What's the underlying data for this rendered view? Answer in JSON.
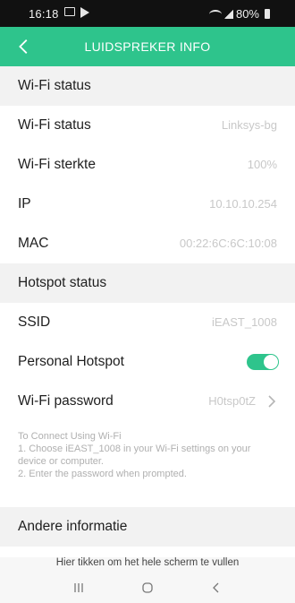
{
  "status_bar": {
    "time": "16:18",
    "battery": "80%"
  },
  "app_bar": {
    "title": "LUIDSPREKER INFO"
  },
  "sections": {
    "wifi_header": "Wi-Fi status",
    "wifi_status": {
      "label": "Wi-Fi status",
      "value": "Linksys-bg"
    },
    "wifi_strength": {
      "label": "Wi-Fi sterkte",
      "value": "100%"
    },
    "ip": {
      "label": "IP",
      "value": "10.10.10.254"
    },
    "mac": {
      "label": "MAC",
      "value": "00:22:6C:6C:10:08"
    },
    "hotspot_header": "Hotspot status",
    "ssid": {
      "label": "SSID",
      "value": "iEAST_1008"
    },
    "personal_hotspot": {
      "label": "Personal Hotspot",
      "enabled": true
    },
    "wifi_password": {
      "label": "Wi-Fi password",
      "value": "H0tsp0tZ"
    },
    "instructions": {
      "line1": "To Connect Using Wi-Fi",
      "line2": "1. Choose iEAST_1008 in your Wi-Fi settings on your device or computer.",
      "line3": "2. Enter the password when prompted."
    },
    "other_header": "Andere informatie"
  },
  "fullscreen_hint": "Hier tikken om het hele scherm te vullen",
  "colors": {
    "accent": "#2ec48c",
    "status_bar": "#111111",
    "section_bg": "#f2f2f2"
  },
  "icons": {
    "back": "arrow-left-icon",
    "chevron": "chevron-right-icon",
    "recents": "recents-icon",
    "home": "home-icon",
    "back_nav": "back-nav-icon"
  }
}
